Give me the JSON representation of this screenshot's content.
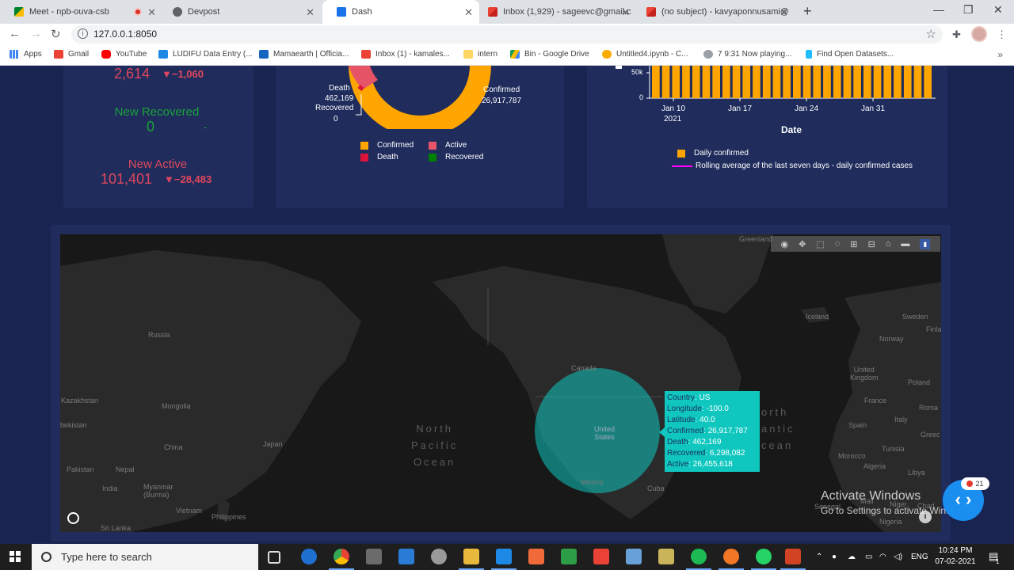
{
  "browser": {
    "tabs": [
      {
        "label": "Meet - npb-ouva-csb",
        "favicon": "google-meet-icon",
        "recording": true
      },
      {
        "label": "Devpost",
        "favicon": "devpost-icon"
      },
      {
        "label": "Dash",
        "favicon": "dash-icon",
        "active": true
      },
      {
        "label": "Inbox (1,929) - sageevc@gmail.c",
        "favicon": "gmail-icon"
      },
      {
        "label": "(no subject) - kavyaponnusami@",
        "favicon": "gmail-icon"
      }
    ],
    "url": "127.0.0.1:8050",
    "bookmarks": [
      {
        "label": "Apps",
        "icon": "apps-grid-icon"
      },
      {
        "label": "Gmail",
        "icon": "gmail-icon"
      },
      {
        "label": "YouTube",
        "icon": "youtube-icon"
      },
      {
        "label": "LUDIFU Data Entry (...",
        "icon": "ludifu-icon"
      },
      {
        "label": "Mamaearth | Officia...",
        "icon": "mamaearth-icon"
      },
      {
        "label": "Inbox (1) - kamales...",
        "icon": "gmail-icon"
      },
      {
        "label": "intern",
        "icon": "folder-icon"
      },
      {
        "label": "Bin - Google Drive",
        "icon": "google-drive-icon"
      },
      {
        "label": "Untitled4.ipynb - C...",
        "icon": "colab-icon"
      },
      {
        "label": "7 9:31 Now playing...",
        "icon": "music-icon"
      },
      {
        "label": "Find Open Datasets...",
        "icon": "kaggle-icon"
      }
    ],
    "bookmarks_more": "»"
  },
  "stats": {
    "top_value": "2,614",
    "top_delta": "▼−1,060",
    "recovered_title": "New Recovered",
    "recovered_value": "0",
    "recovered_delta": "-",
    "active_title": "New Active",
    "active_value": "101,401",
    "active_delta": "▼−28,483"
  },
  "donut": {
    "label_death": "Death",
    "value_death": "462,169",
    "label_recovered": "Recovered",
    "value_recovered": "0",
    "label_confirmed": "Confirmed",
    "value_confirmed": "26,917,787",
    "legend": [
      {
        "name": "Confirmed",
        "color": "#FFA500"
      },
      {
        "name": "Active",
        "color": "#E55467"
      },
      {
        "name": "Death",
        "color": "#DC143C"
      },
      {
        "name": "Recovered",
        "color": "#008000"
      }
    ]
  },
  "chart_data": {
    "type": "bar",
    "xlabel": "Date",
    "x_ticks": [
      "Jan 10\n2021",
      "Jan 17",
      "Jan 24",
      "Jan 31"
    ],
    "y_ticks": [
      "0",
      "50k"
    ],
    "bar_count": 28,
    "series": [
      {
        "name": "Daily confirmed",
        "color": "#FFA500"
      },
      {
        "name": "Rolling average of the last seven days - daily confirmed cases",
        "color": "#FF00FF"
      }
    ],
    "x_tick_1": "Jan 10",
    "x_tick_1b": "2021",
    "x_tick_2": "Jan 17",
    "x_tick_3": "Jan 24",
    "x_tick_4": "Jan 31",
    "y_tick_0": "0",
    "y_tick_1": "50k"
  },
  "map": {
    "labels": {
      "greenland": "Greenland",
      "russia": "Russia",
      "kazakhstan": "Kazakhstan",
      "mongolia": "Mongolia",
      "uzbekistan": "bekistan",
      "china": "China",
      "japan": "Japan",
      "pakistan": "Pakistan",
      "nepal": "Nepal",
      "india": "India",
      "myanmar": "Myanmar\n(Burma)",
      "vietnam": "Vietnam",
      "philippines": "Philippines",
      "srilanka": "Sri Lanka",
      "canada": "Canada",
      "united_states": "United\nStates",
      "mexico": "Mexico",
      "cuba": "Cuba",
      "iceland": "Iceland",
      "sweden": "Sweden",
      "finland": "Finla",
      "norway": "Norway",
      "uk": "United\nKingdom",
      "poland": "Poland",
      "france": "France",
      "romania": "Roma",
      "spain": "Spain",
      "italy": "Italy",
      "greece": "Greec",
      "tunisia": "Tunisia",
      "morocco": "Morocco",
      "algeria": "Algeria",
      "libya": "Libya",
      "senegal": "Senegal",
      "mali": "Mali",
      "niger": "Niger",
      "chad": "Chad",
      "nigeria": "Nigeria",
      "north_pacific": "North\nPacific\nOcean",
      "north_atlantic": "orth\nantic\ncean"
    },
    "hover": {
      "country_key": "Country",
      "country": "US",
      "longitude_key": "Longitude",
      "longitude": "-100.0",
      "latitude_key": "Latitude",
      "latitude": "40.0",
      "confirmed_key": "Confirmed",
      "confirmed": "26,917,787",
      "death_key": "Death",
      "death": "462,169",
      "recovered_key": "Recovered",
      "recovered": "6,298,082",
      "active_key": "Active",
      "active": "26,455,618"
    }
  },
  "watermark": {
    "line1": "Activate Windows",
    "line2": "Go to Settings to activate Windows."
  },
  "fab": {
    "badge_count": "21",
    "glyph": "‹ ›"
  },
  "taskbar": {
    "search_placeholder": "Type here to search",
    "language": "ENG",
    "time": "10:24 PM",
    "date": "07-02-2021",
    "notification_count": "1"
  }
}
